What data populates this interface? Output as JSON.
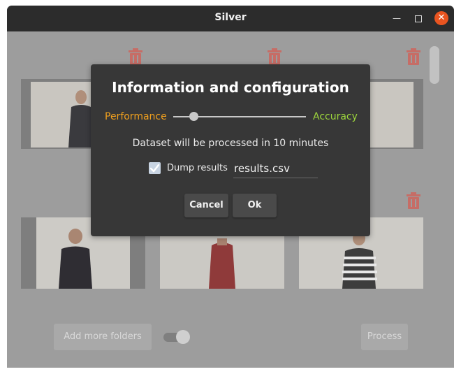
{
  "window": {
    "title": "Silver"
  },
  "main": {
    "add_folders_label": "Add more folders",
    "process_label": "Process"
  },
  "dialog": {
    "title": "Information and configuration",
    "slider_left_label": "Performance",
    "slider_right_label": "Accuracy",
    "slider_value": 0.13,
    "info_text": "Dataset will be processed in 10 minutes",
    "dump_label": "Dump results",
    "dump_checked": true,
    "filename_value": "results.csv",
    "cancel_label": "Cancel",
    "ok_label": "Ok"
  },
  "colors": {
    "performance": "#f0a01e",
    "accuracy": "#9dd63c",
    "close_button": "#e95420",
    "trash": "#e8463a"
  },
  "icons": [
    "trash-icon",
    "minimize-icon",
    "maximize-icon",
    "close-icon",
    "checkmark-icon"
  ]
}
